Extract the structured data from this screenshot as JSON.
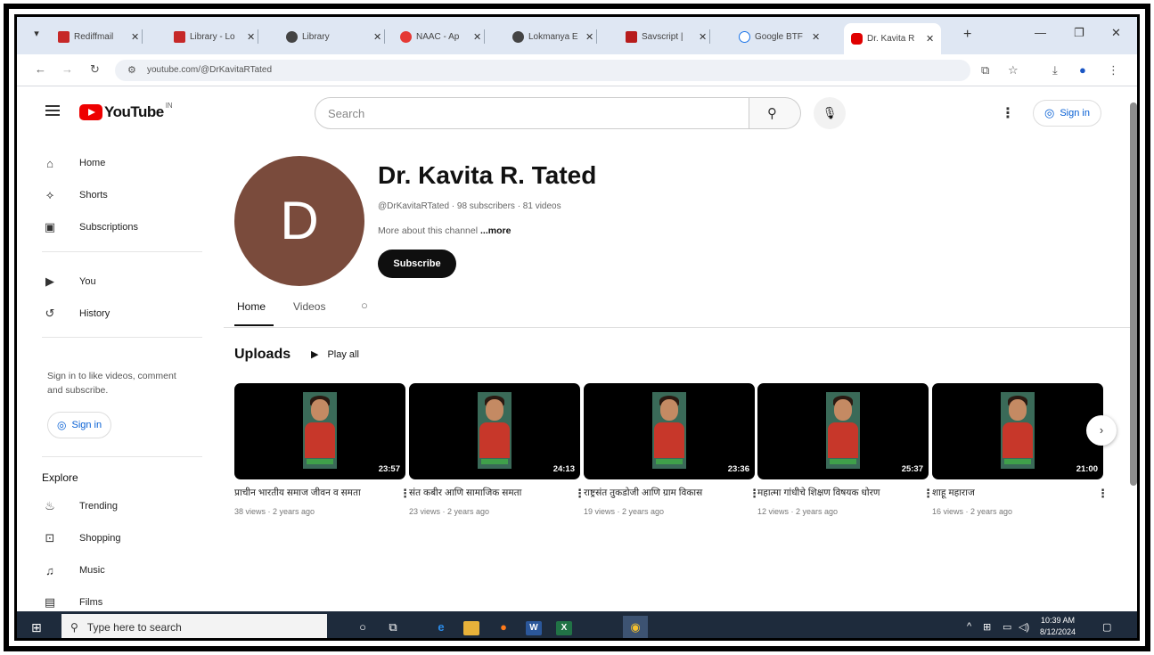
{
  "browser": {
    "tabs": [
      {
        "label": "Rediffmail",
        "color": "#c62828"
      },
      {
        "label": "Library - Lo",
        "color": "#c62828"
      },
      {
        "label": "Library",
        "color": "#444444"
      },
      {
        "label": "NAAC - Ap",
        "color": "#e53935"
      },
      {
        "label": "Lokmanya E",
        "color": "#444444"
      },
      {
        "label": "Savscript |",
        "color": "#b71c1c"
      },
      {
        "label": "Google BTF",
        "color": "#1a73e8"
      },
      {
        "label": "Dr. Kavita R",
        "color": "#e00000"
      }
    ],
    "url": "youtube.com/@DrKavitaRTated"
  },
  "youtube": {
    "logo_text": "YouTube",
    "region": "IN",
    "search_placeholder": "Search",
    "sign_in": "Sign in"
  },
  "sidebar": {
    "primary": [
      {
        "label": "Home",
        "icon": "home-icon"
      },
      {
        "label": "Shorts",
        "icon": "shorts-icon"
      },
      {
        "label": "Subscriptions",
        "icon": "subscriptions-icon"
      }
    ],
    "secondary": [
      {
        "label": "You",
        "icon": "you-icon"
      },
      {
        "label": "History",
        "icon": "history-icon"
      }
    ],
    "note": "Sign in to like videos, comment and subscribe.",
    "sign_in": "Sign in",
    "explore_heading": "Explore",
    "explore": [
      {
        "label": "Trending",
        "icon": "trending-icon"
      },
      {
        "label": "Shopping",
        "icon": "shopping-icon"
      },
      {
        "label": "Music",
        "icon": "music-icon"
      },
      {
        "label": "Films",
        "icon": "films-icon"
      }
    ]
  },
  "channel": {
    "avatar_letter": "D",
    "avatar_color": "#7a4b3c",
    "name": "Dr. Kavita R. Tated",
    "meta": "@DrKavitaRTated · 98 subscribers · 81 videos",
    "about": "More about this channel",
    "about_more": "...more",
    "subscribe": "Subscribe",
    "tabs": [
      "Home",
      "Videos"
    ],
    "active_tab": "Home"
  },
  "uploads": {
    "heading": "Uploads",
    "play_all": "Play all",
    "videos": [
      {
        "title": "प्राचीन भारतीय समाज जीवन व समता",
        "duration": "23:57",
        "meta": "38 views · 2 years ago"
      },
      {
        "title": "संत कबीर आणि सामाजिक समता",
        "duration": "24:13",
        "meta": "23 views · 2 years ago"
      },
      {
        "title": "राष्ट्रसंत तुकडोजी आणि ग्राम विकास",
        "duration": "23:36",
        "meta": "19 views · 2 years ago"
      },
      {
        "title": "महात्मा गांधीचे शिक्षण विषयक धोरण",
        "duration": "25:37",
        "meta": "12 views · 2 years ago"
      },
      {
        "title": "शाहू महाराज",
        "duration": "21:00",
        "meta": "16 views · 2 years ago"
      }
    ]
  },
  "taskbar": {
    "search_placeholder": "Type here to search",
    "time": "10:39 AM",
    "date": "8/12/2024"
  }
}
